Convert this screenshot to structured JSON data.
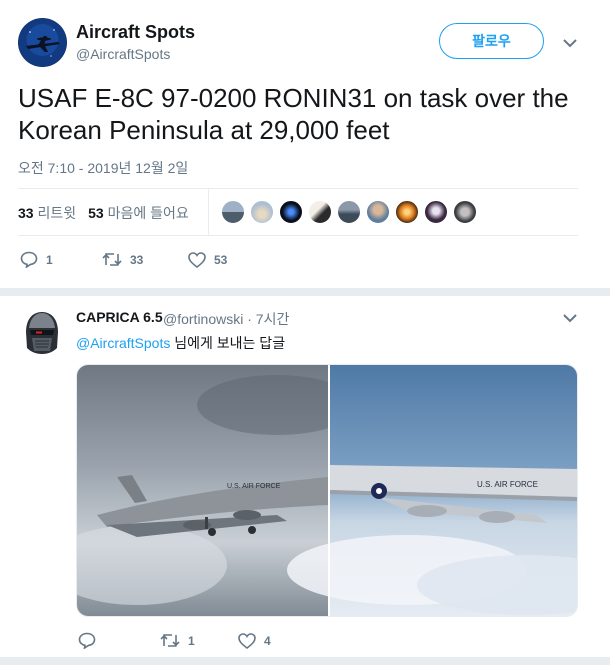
{
  "tweet": {
    "display_name": "Aircraft Spots",
    "handle": "@AircraftSpots",
    "follow_label": "팔로우",
    "text": "USAF E-8C 97-0200 RONIN31 on task over the Korean Peninsula at 29,000 feet",
    "timestamp": "오전 7:10 - 2019년 12월 2일",
    "retweets_count": "33",
    "retweets_label": "리트윗",
    "likes_count": "53",
    "likes_label": "마음에 들어요",
    "actions": {
      "reply_count": "1",
      "retweet_count": "33",
      "like_count": "53"
    },
    "likers": [
      {
        "color": "#7c8ea3"
      },
      {
        "color": "#b9c6d6"
      },
      {
        "color": "#0c1220"
      },
      {
        "color": "#c9b79a"
      },
      {
        "color": "#5d6a78"
      },
      {
        "color": "#6f8ca6"
      },
      {
        "color": "#c9741c"
      },
      {
        "color": "#3a2740"
      },
      {
        "color": "#6d6e73"
      }
    ]
  },
  "reply": {
    "display_name": "CAPRICA 6.5",
    "handle_time": "@fortinowski · 7시간",
    "reply_mention": "@AircraftSpots",
    "reply_suffix": " 님에게 보내는 답글",
    "actions": {
      "reply_count": "",
      "retweet_count": "1",
      "like_count": "4"
    }
  },
  "colors": {
    "accent": "#1da1f2",
    "secondary_text": "#657786",
    "divider": "#e6ecf0"
  }
}
